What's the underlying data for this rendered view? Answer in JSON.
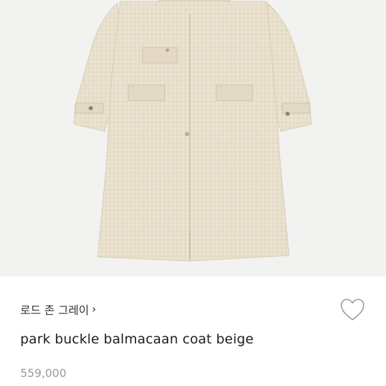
{
  "product_image": {
    "icon": "coat-photo",
    "background": "#f2f2f0",
    "coat_color": "#e8dfcc"
  },
  "product": {
    "brand": "로드 존 그레이",
    "brand_chevron": "›",
    "name": "park buckle balmacaan coat beige",
    "price": "559,000"
  },
  "actions": {
    "like_icon": "heart-outline-icon"
  }
}
